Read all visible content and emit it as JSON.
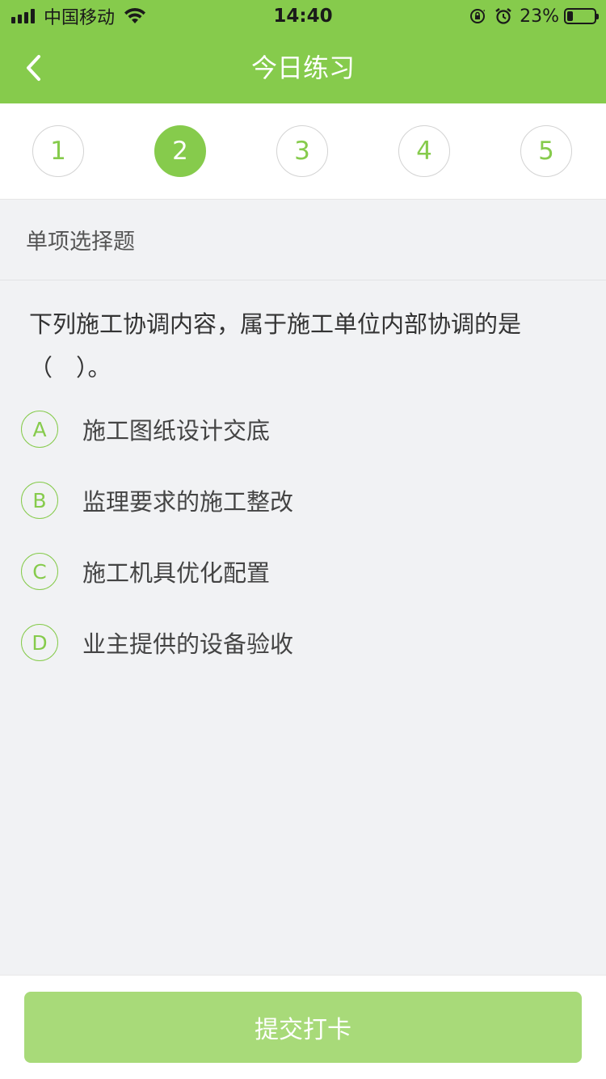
{
  "status_bar": {
    "carrier": "中国移动",
    "time": "14:40",
    "battery_percent": "23%",
    "battery_level": 0.23,
    "icons": [
      "signal-icon",
      "wifi-icon",
      "orientation-lock-icon",
      "alarm-icon",
      "battery-icon"
    ]
  },
  "header": {
    "title": "今日练习",
    "back_icon": "chevron-left-icon",
    "color": "#86cb4c"
  },
  "steps": [
    {
      "label": "1",
      "active": false
    },
    {
      "label": "2",
      "active": true
    },
    {
      "label": "3",
      "active": false
    },
    {
      "label": "4",
      "active": false
    },
    {
      "label": "5",
      "active": false
    }
  ],
  "question": {
    "type": "单项选择题",
    "text_line1": "下列施工协调内容，属于施工单位内部协调的是",
    "text_line2": "（　）。",
    "options": [
      {
        "letter": "A",
        "text": "施工图纸设计交底"
      },
      {
        "letter": "B",
        "text": "监理要求的施工整改"
      },
      {
        "letter": "C",
        "text": "施工机具优化配置"
      },
      {
        "letter": "D",
        "text": "业主提供的设备验收"
      }
    ]
  },
  "footer": {
    "submit_label": "提交打卡",
    "submit_color": "#a8da79"
  }
}
